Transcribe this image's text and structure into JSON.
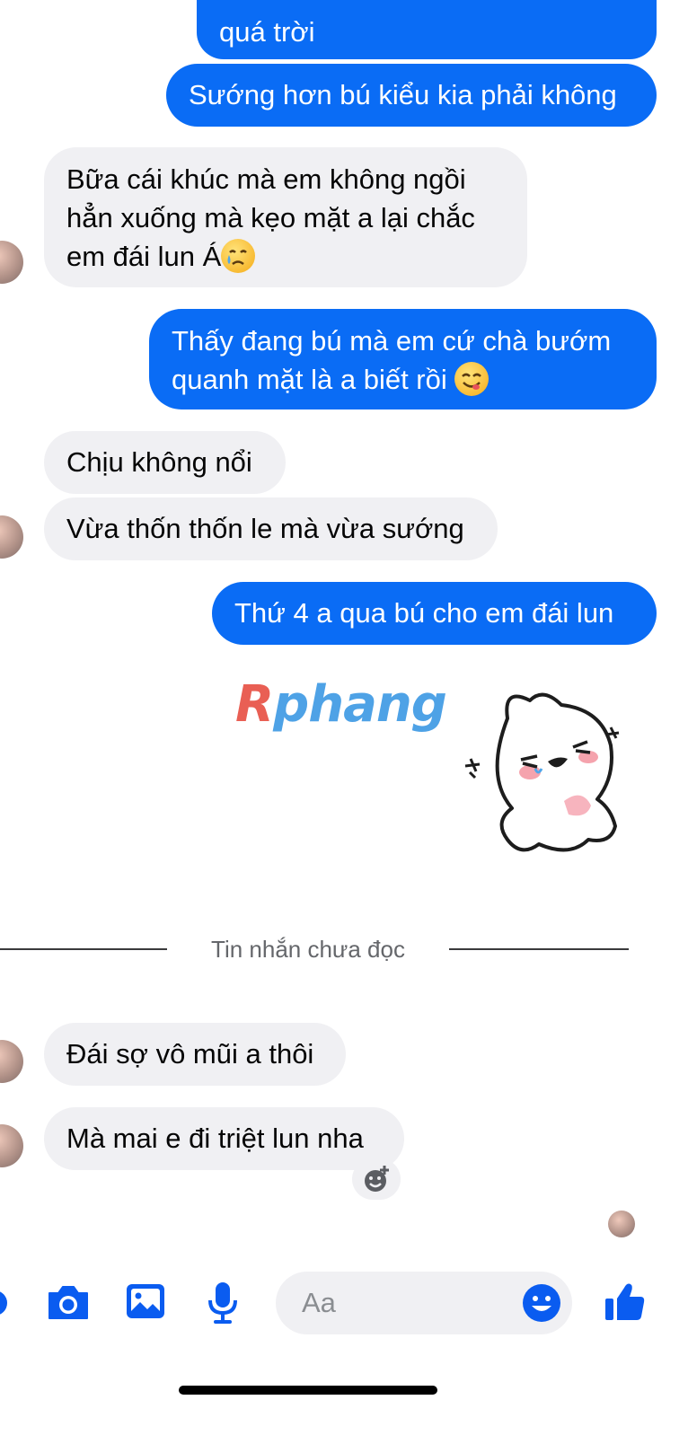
{
  "messages": [
    {
      "id": "m0",
      "direction": "outgoing",
      "text": "quá trời"
    },
    {
      "id": "m1",
      "direction": "outgoing",
      "text": "Sướng hơn bú kiểu kia phải không"
    },
    {
      "id": "m2",
      "direction": "incoming",
      "lines": [
        "Bữa cái khúc mà em không ngồi",
        "hẳn xuống mà kẹo mặt a lại chắc",
        "em đái lun Á"
      ],
      "emoji": "crying-face"
    },
    {
      "id": "m3",
      "direction": "outgoing",
      "lines": [
        "Thấy đang bú mà em cứ chà bướm",
        "quanh mặt là a biết rồi"
      ],
      "emoji": "yum-face"
    },
    {
      "id": "m4",
      "direction": "incoming",
      "text": "Chịu không nổi"
    },
    {
      "id": "m5",
      "direction": "incoming",
      "text": "Vừa thốn thốn le mà vừa sướng"
    },
    {
      "id": "m6",
      "direction": "outgoing",
      "text": "Thứ 4 a qua bú cho em đái lun"
    },
    {
      "id": "m7",
      "direction": "outgoing",
      "type": "sticker",
      "sticker": "crying-laughing-bunny"
    },
    {
      "id": "m8",
      "direction": "incoming",
      "text": "Đái sợ vô mũi a thôi"
    },
    {
      "id": "m9",
      "direction": "incoming",
      "text": "Mà mai e đi triệt lun nha"
    }
  ],
  "unread_divider": "Tin nhắn chưa đọc",
  "watermark": "Rphang",
  "composer": {
    "placeholder": "Aa",
    "icons": [
      "more-icon",
      "camera-icon",
      "image-icon",
      "mic-icon",
      "emoji-icon",
      "thumbs-up-icon"
    ]
  },
  "colors": {
    "outgoing_bubble": "#0a6cf5",
    "incoming_bubble": "#f0f0f3",
    "accent": "#0a5cf0",
    "meta_text": "#65676b"
  }
}
